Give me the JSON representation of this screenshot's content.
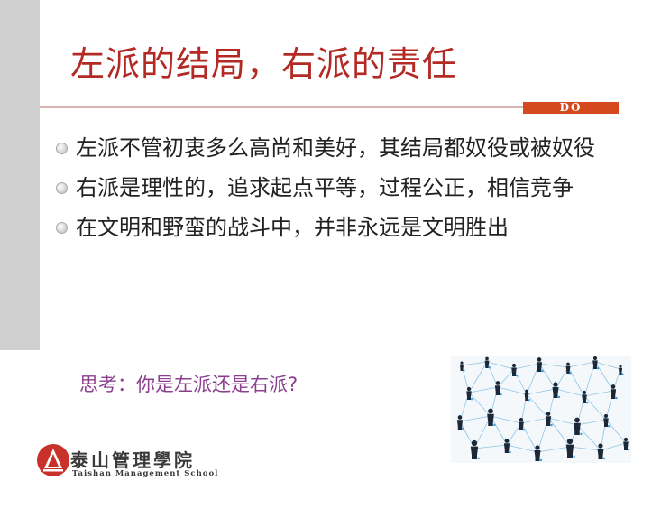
{
  "slide": {
    "title": "左派的结局，右派的责任",
    "tag": "DO",
    "bullets": [
      "左派不管初衷多么高尚和美好，其结局都奴役或被奴役",
      "右派是理性的，追求起点平等，过程公正，相信竞争",
      "在文明和野蛮的战斗中，并非永远是文明胜出"
    ],
    "question": "思考：你是左派还是右派?"
  },
  "logo": {
    "name_cn": "泰山管理學院",
    "name_en": "Taishan Management School"
  },
  "colors": {
    "title": "#b32a24",
    "tag_bg": "#d4491d",
    "question": "#8b3f8f",
    "side_bar": "#cfcfcf"
  },
  "icons": [
    "bullet-dot-icon",
    "school-logo-icon",
    "people-network-icon"
  ]
}
